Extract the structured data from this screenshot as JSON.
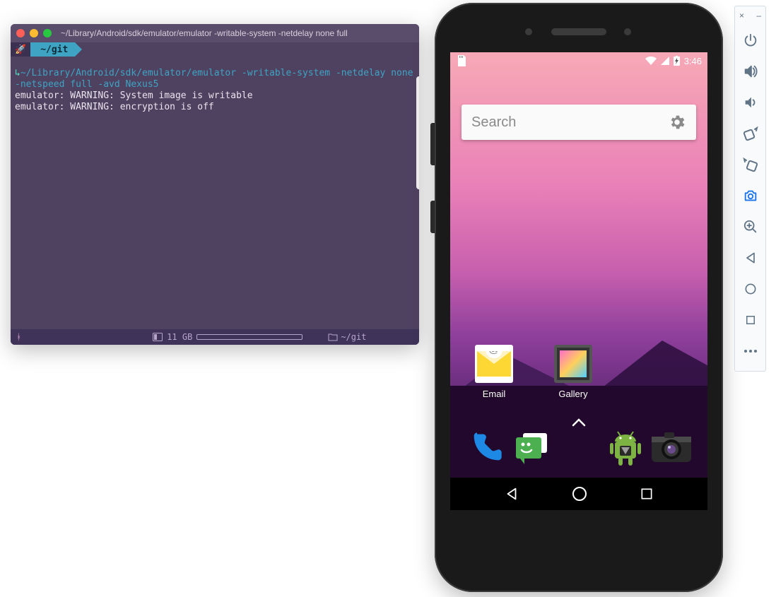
{
  "terminal": {
    "title": "~/Library/Android/sdk/emulator/emulator -writable-system -netdelay none  full",
    "prompt_path": "~/git",
    "cmd_prefix": "↳",
    "cmd_line": "~/Library/Android/sdk/emulator/emulator -writable-system -netdelay none -netspeed full -avd Nexus5",
    "output_lines": [
      "emulator: WARNING: System image is writable",
      "emulator: WARNING: encryption is off"
    ],
    "statusbar": {
      "branch_glyph": "ᚼ",
      "disk_label": "11 GB",
      "folder_label": "~/git"
    }
  },
  "phone": {
    "status": {
      "time": "3:46"
    },
    "search_placeholder": "Search",
    "apps": [
      {
        "label": "Email"
      },
      {
        "label": "Gallery"
      }
    ]
  },
  "toolbar": {
    "close_glyph": "×",
    "minimize_glyph": "–",
    "buttons": [
      {
        "name": "power"
      },
      {
        "name": "volume-up"
      },
      {
        "name": "volume-down"
      },
      {
        "name": "rotate-left"
      },
      {
        "name": "rotate-right"
      },
      {
        "name": "screenshot"
      },
      {
        "name": "zoom"
      },
      {
        "name": "back"
      },
      {
        "name": "home"
      },
      {
        "name": "overview"
      },
      {
        "name": "more"
      }
    ]
  }
}
